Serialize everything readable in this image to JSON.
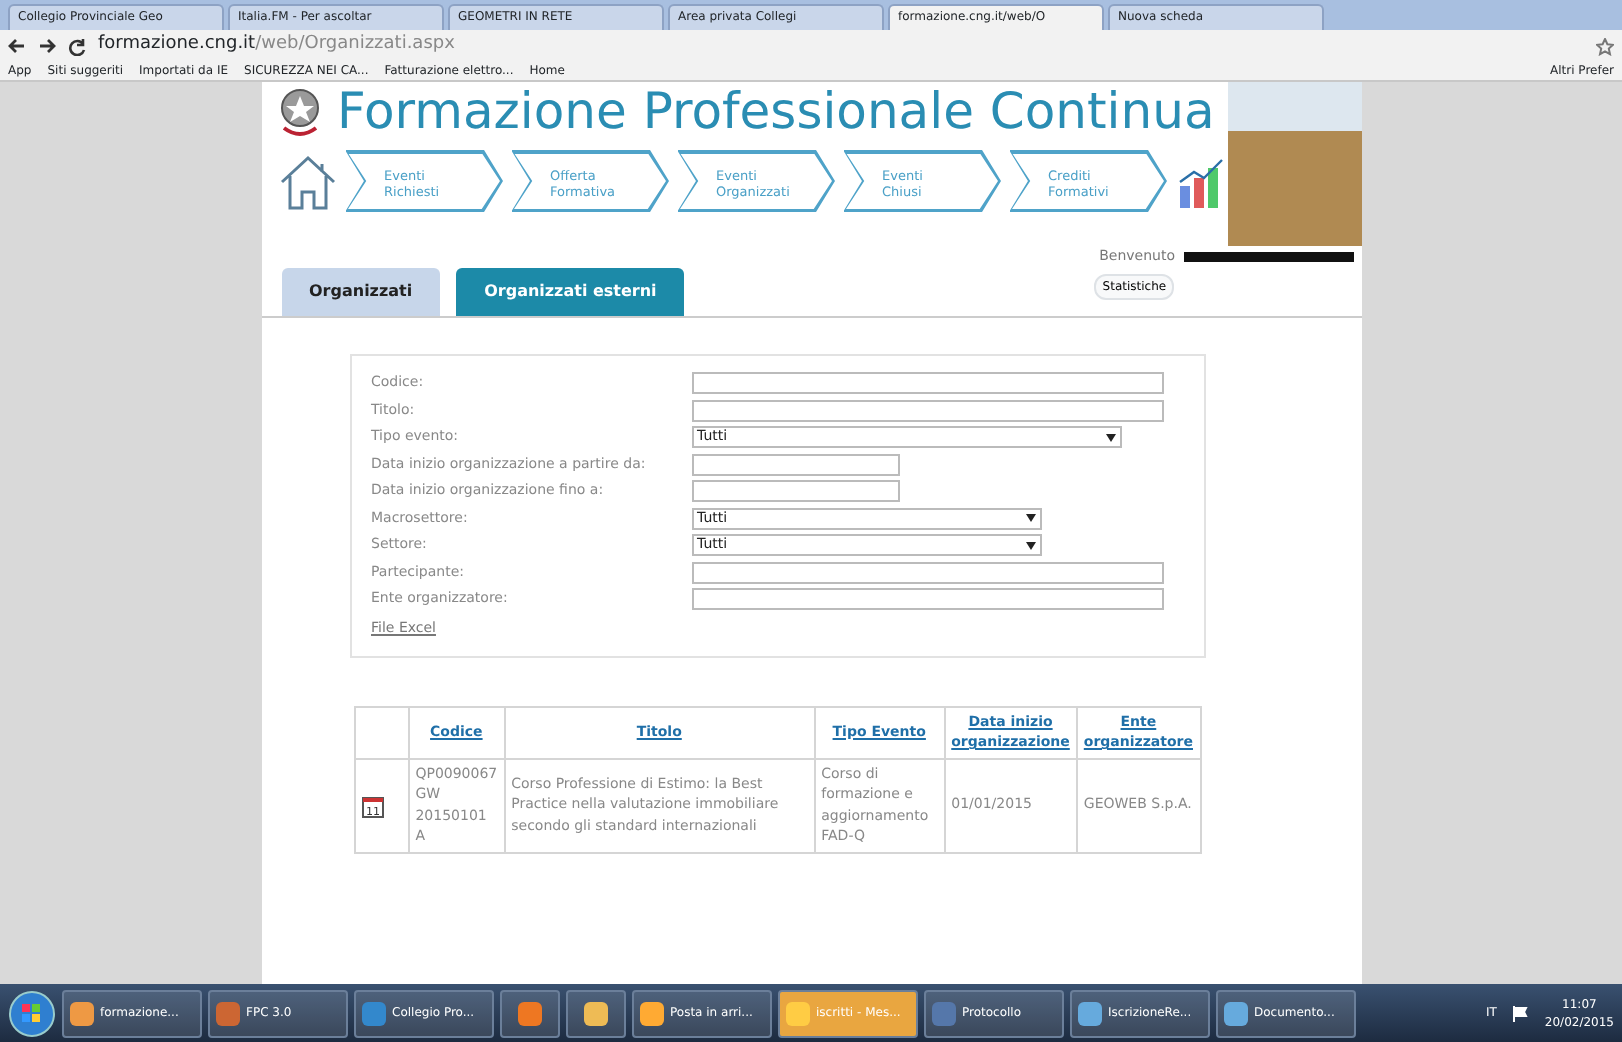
{
  "browser": {
    "tabs": [
      {
        "title": "Collegio Provinciale Geo",
        "selected": false
      },
      {
        "title": "Italia.FM - Per ascoltar",
        "selected": false
      },
      {
        "title": "GEOMETRI IN RETE",
        "selected": false
      },
      {
        "title": "Area privata Collegi",
        "selected": false
      },
      {
        "title": "formazione.cng.it/web/O",
        "selected": true
      },
      {
        "title": "Nuova scheda",
        "selected": false
      }
    ],
    "address": {
      "host": "formazione.cng.it",
      "path": "/web/Organizzati.aspx"
    },
    "bookmarks": [
      "App",
      "Siti suggeriti",
      "Importati da IE",
      "SICUREZZA NEI CA...",
      "Fatturazione elettro...",
      "Home"
    ],
    "other_bookmarks": "Altri Prefer"
  },
  "page": {
    "title": "Formazione Professionale Continua",
    "steps": [
      "Eventi Richiesti",
      "Offerta Formativa",
      "Eventi Organizzati",
      "Eventi Chiusi",
      "Crediti Formativi"
    ],
    "welcome": "Benvenuto",
    "stats_button": "Statistiche",
    "tabs": [
      {
        "label": "Organizzati",
        "selected": false
      },
      {
        "label": "Organizzati esterni",
        "selected": true
      }
    ],
    "form": [
      {
        "label": "Codice:",
        "kind": "text"
      },
      {
        "label": "Titolo:",
        "kind": "text"
      },
      {
        "label": "Tipo evento:",
        "kind": "wideselect",
        "value": "Tutti"
      },
      {
        "label": "Data inizio organizzazione a partire da:",
        "kind": "date"
      },
      {
        "label": "Data inizio organizzazione fino a:",
        "kind": "date"
      },
      {
        "label": "Macrosettore:",
        "kind": "select",
        "value": "Tutti"
      },
      {
        "label": "Settore:",
        "kind": "select",
        "value": "Tutti"
      },
      {
        "label": "Partecipante:",
        "kind": "text"
      },
      {
        "label": "Ente organizzatore:",
        "kind": "text"
      }
    ],
    "excel_link": "File Excel",
    "table": {
      "columns": [
        "Codice",
        "Titolo",
        "Tipo Evento",
        "Data inizio organizzazione",
        "Ente organizzatore"
      ],
      "rows": [
        {
          "icon_day": "11",
          "cells": [
            "QP0090067 GW 20150101 A",
            "Corso Professione di Estimo: la Best Practice nella valutazione immobiliare secondo gli standard internazionali",
            "Corso di formazione e aggiornamento FAD-Q",
            "01/01/2015",
            "GEOWEB S.p.A."
          ]
        }
      ]
    }
  },
  "taskbar": {
    "items": [
      {
        "label": "formazione...",
        "flashing": false
      },
      {
        "label": "FPC 3.0",
        "flashing": false
      },
      {
        "label": "Collegio Pro...",
        "flashing": false
      },
      {
        "flashing": false
      },
      {
        "flashing": false
      },
      {
        "label": "Posta in arri...",
        "flashing": false
      },
      {
        "label": "iscritti - Mes...",
        "flashing": true
      },
      {
        "label": "Protocollo",
        "flashing": false
      },
      {
        "label": "IscrizioneRe...",
        "flashing": false
      },
      {
        "label": "Documento...",
        "flashing": false
      }
    ],
    "language": "IT",
    "time": "11:07",
    "date": "20/02/2015"
  }
}
